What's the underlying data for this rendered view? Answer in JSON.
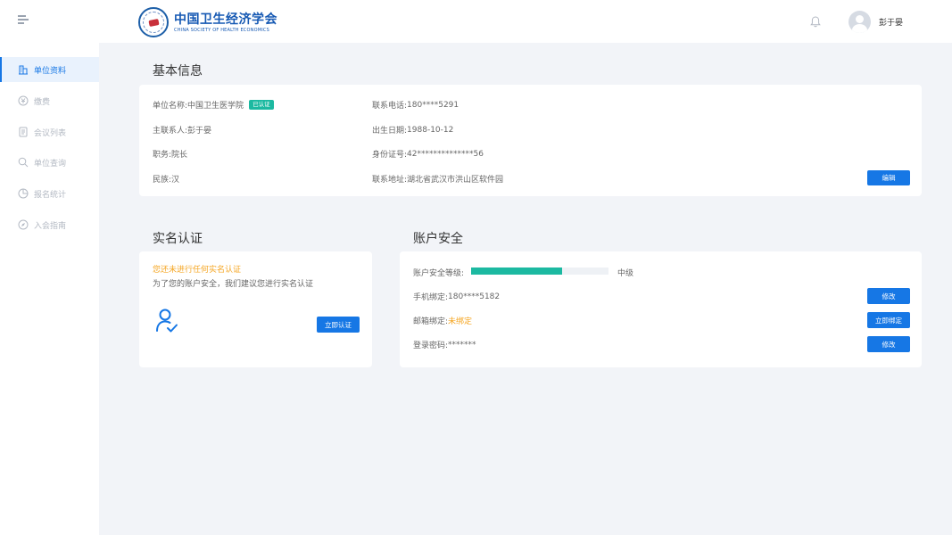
{
  "header": {
    "logo_cn": "中国卫生经济学会",
    "logo_en": "CHINA SOCIETY OF HEALTH ECONOMICS",
    "user_name": "彭于晏",
    "icons": [
      "menu-toggle-icon",
      "bell-icon",
      "user-avatar-icon"
    ]
  },
  "sidebar": {
    "items": [
      {
        "label": "单位资料",
        "icon": "building-icon",
        "active": true
      },
      {
        "label": "缴费",
        "icon": "payment-icon",
        "active": false
      },
      {
        "label": "会议列表",
        "icon": "document-list-icon",
        "active": false
      },
      {
        "label": "单位查询",
        "icon": "search-icon",
        "active": false
      },
      {
        "label": "报名统计",
        "icon": "pie-chart-icon",
        "active": false
      },
      {
        "label": "入会指南",
        "icon": "compass-icon",
        "active": false
      }
    ]
  },
  "basic_info": {
    "title": "基本信息",
    "unit_name_label": "单位名称:",
    "unit_name": "中国卫生医学院",
    "verified_badge": "已认证",
    "contact_label": "主联系人:",
    "contact": "彭于晏",
    "position_label": "职务:",
    "position": "院长",
    "ethnicity_label": "民族:",
    "ethnicity": "汉",
    "phone_label": "联系电话:",
    "phone": "180****5291",
    "birth_label": "出生日期:",
    "birth": "1988-10-12",
    "id_label": "身份证号:",
    "id_number": "42**************56",
    "address_label": "联系地址:",
    "address": "湖北省武汉市洪山区软件园",
    "edit_button": "编辑"
  },
  "real_name": {
    "title": "实名认证",
    "warning": "您还未进行任何实名认证",
    "hint": "为了您的账户安全，我们建议您进行实名认证",
    "icon": "user-check-icon",
    "button": "立即认证"
  },
  "security": {
    "title": "账户安全",
    "level_label": "账户安全等级:",
    "level_value": 0.66,
    "level_text": "中级",
    "phone_label": "手机绑定:",
    "phone": "180****5182",
    "phone_button": "修改",
    "email_label": "邮箱绑定:",
    "email_status": "未绑定",
    "email_button": "立即绑定",
    "password_label": "登录密码:",
    "password": "*******",
    "password_button": "修改"
  },
  "colors": {
    "primary": "#1677e5",
    "success": "#1cb9a1",
    "warning": "#f5a623",
    "background": "#f2f4f8"
  }
}
